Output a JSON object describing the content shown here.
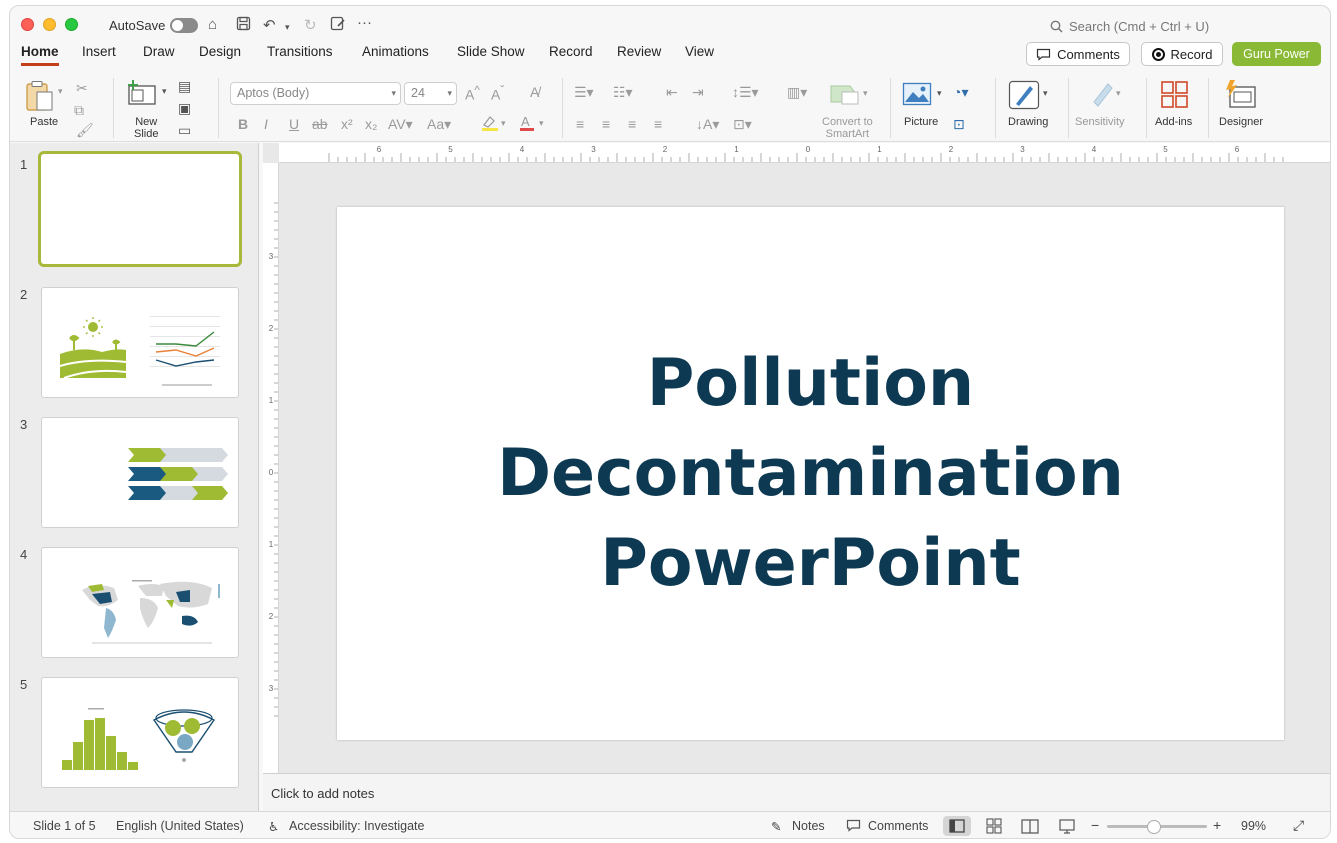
{
  "titlebar": {
    "autosave_label": "AutoSave",
    "search_placeholder": "Search (Cmd + Ctrl + U)"
  },
  "tabs": [
    {
      "label": "Home",
      "active": true
    },
    {
      "label": "Insert"
    },
    {
      "label": "Draw"
    },
    {
      "label": "Design"
    },
    {
      "label": "Transitions"
    },
    {
      "label": "Animations"
    },
    {
      "label": "Slide Show"
    },
    {
      "label": "Record"
    },
    {
      "label": "Review"
    },
    {
      "label": "View"
    }
  ],
  "header_buttons": {
    "comments": "Comments",
    "record": "Record",
    "guru": "Guru Power"
  },
  "ribbon": {
    "paste": "Paste",
    "new_slide": "New\nSlide",
    "font_name": "Aptos (Body)",
    "font_size": "24",
    "convert_smartart": "Convert to\nSmartArt",
    "picture": "Picture",
    "drawing": "Drawing",
    "sensitivity": "Sensitivity",
    "addins": "Add-ins",
    "designer": "Designer"
  },
  "thumbnails": [
    {
      "num": "1"
    },
    {
      "num": "2"
    },
    {
      "num": "3"
    },
    {
      "num": "4"
    },
    {
      "num": "5"
    }
  ],
  "slide": {
    "title_line1": "Pollution",
    "title_line2": "Decontamination",
    "title_line3": "PowerPoint",
    "title_color": "#0d3a52"
  },
  "notes": {
    "placeholder": "Click to add notes"
  },
  "status": {
    "slide_count": "Slide 1 of 5",
    "language": "English (United States)",
    "accessibility": "Accessibility: Investigate",
    "notes": "Notes",
    "comments": "Comments",
    "zoom": "99%"
  },
  "rulers": {
    "h_labels": [
      "6",
      "5",
      "4",
      "3",
      "2",
      "1",
      "0",
      "1",
      "2",
      "3",
      "4",
      "5",
      "6"
    ],
    "v_labels": [
      "3",
      "2",
      "1",
      "0",
      "1",
      "2",
      "3"
    ]
  },
  "colors": {
    "accent_green": "#8ab935",
    "tab_underline": "#c43e1c",
    "navy": "#0d3a52"
  }
}
